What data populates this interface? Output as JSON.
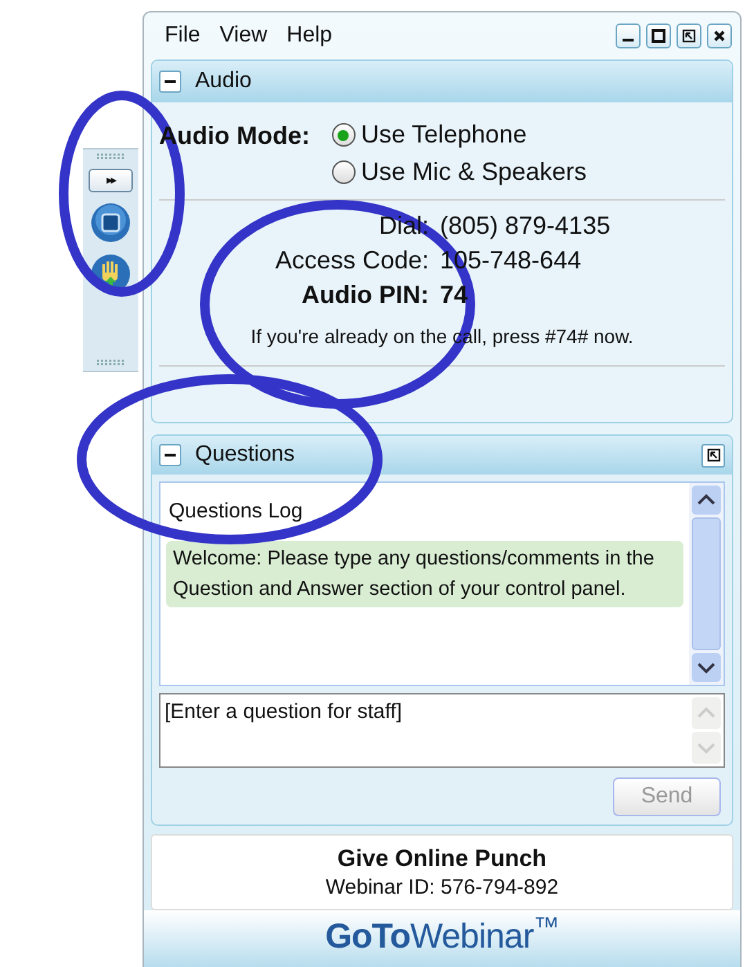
{
  "menu": [
    "File",
    "View",
    "Help"
  ],
  "window_controls": [
    {
      "kind": "minimize"
    },
    {
      "kind": "maximize"
    },
    {
      "kind": "restore"
    },
    {
      "kind": "close"
    }
  ],
  "dock": {
    "items": [
      {
        "kind": "expand",
        "label": "▸▸"
      },
      {
        "kind": "screen"
      },
      {
        "kind": "hand"
      }
    ]
  },
  "audio": {
    "title": "Audio",
    "expanded": true,
    "mode_label": "Audio Mode:",
    "modes": [
      {
        "label": "Use Telephone",
        "selected": true
      },
      {
        "label": "Use Mic & Speakers",
        "selected": false
      }
    ],
    "details": [
      {
        "label": "Dial:",
        "value": "(805) 879-4135",
        "bold": false
      },
      {
        "label": "Access Code:",
        "value": "105-748-644",
        "bold": false
      },
      {
        "label": "Audio PIN:",
        "value": "74",
        "bold": true
      }
    ],
    "note": "If you're already on the call, press #74# now."
  },
  "questions": {
    "title": "Questions",
    "expanded": true,
    "log_title": "Questions Log",
    "messages": [
      "Welcome: Please type any questions/comments in the Question and Answer section of your control panel."
    ],
    "input": {
      "placeholder": "[Enter a question for staff]"
    },
    "send": {
      "label": "Send",
      "disabled": true
    }
  },
  "footer": {
    "title": "Give Online Punch",
    "webinar_id": "Webinar ID: 576-794-892",
    "logo": "**GoTo**Webinar$^{™}$"
  }
}
